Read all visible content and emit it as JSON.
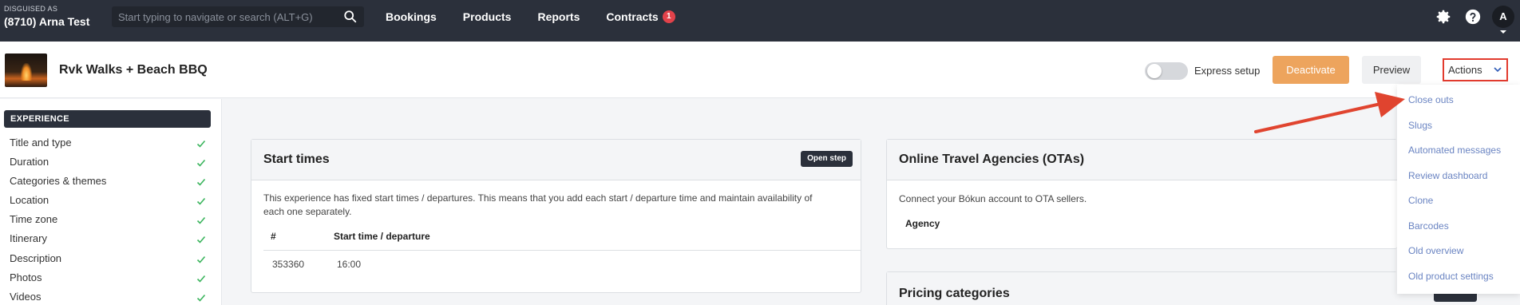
{
  "topnav": {
    "disguised_label": "DISGUISED AS",
    "user_name": "(8710) Arna Test",
    "search_placeholder": "Start typing to navigate or search (ALT+G)",
    "links": [
      {
        "label": "Bookings"
      },
      {
        "label": "Products"
      },
      {
        "label": "Reports"
      },
      {
        "label": "Contracts",
        "badge": "1"
      }
    ],
    "icons": [
      "gear-icon",
      "help-icon"
    ],
    "avatar_initial": "A"
  },
  "product": {
    "title": "Rvk Walks + Beach BBQ",
    "express_setup_label": "Express setup",
    "express_setup_on": false,
    "deactivate_label": "Deactivate",
    "preview_label": "Preview",
    "actions_label": "Actions"
  },
  "sidebar": {
    "section_title": "EXPERIENCE",
    "items": [
      {
        "label": "Title and type",
        "done": true
      },
      {
        "label": "Duration",
        "done": true
      },
      {
        "label": "Categories & themes",
        "done": true
      },
      {
        "label": "Location",
        "done": true
      },
      {
        "label": "Time zone",
        "done": true
      },
      {
        "label": "Itinerary",
        "done": true
      },
      {
        "label": "Description",
        "done": true
      },
      {
        "label": "Photos",
        "done": true
      },
      {
        "label": "Videos",
        "done": true
      }
    ]
  },
  "start_times": {
    "title": "Start times",
    "button": "Open step",
    "description": "This experience has fixed start times / departures. This means that you add each start / departure time and maintain availability of each one separately.",
    "columns": [
      "#",
      "Start time / departure"
    ],
    "rows": [
      [
        "353360",
        "16:00"
      ]
    ]
  },
  "otas": {
    "title": "Online Travel Agencies (OTAs)",
    "description": "Connect your Bókun account to OTA sellers.",
    "column": "Agency"
  },
  "pricing": {
    "title": "Pricing categories"
  },
  "actions_menu": {
    "items": [
      "Close outs",
      "Slugs",
      "Automated messages",
      "Review dashboard",
      "Clone",
      "Barcodes",
      "Old overview",
      "Old product settings"
    ]
  },
  "colors": {
    "nav_bg": "#2b303b",
    "deactivate": "#eda45d",
    "link": "#6a84c2",
    "highlight": "#e23b2e",
    "check": "#3cb55e"
  }
}
